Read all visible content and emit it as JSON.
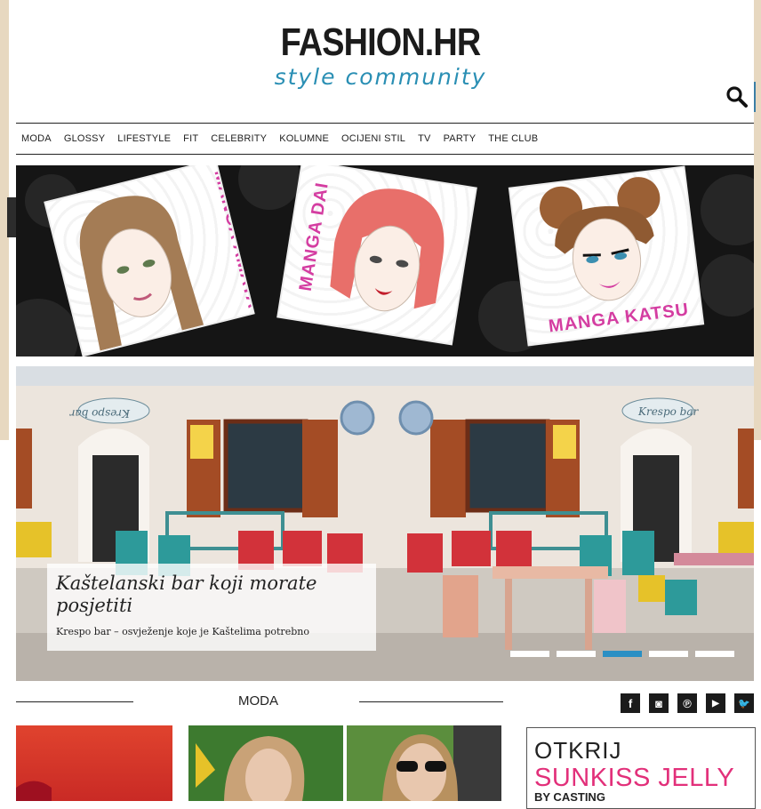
{
  "logo": {
    "main": "FASHION.HR",
    "sub": "style community"
  },
  "search": {
    "icon": "search-icon"
  },
  "nav": {
    "items": [
      "MODA",
      "GLOSSY",
      "LIFESTYLE",
      "FIT",
      "CELEBRITY",
      "KOLUMNE",
      "OCIJENI STIL",
      "TV",
      "PARTY",
      "THE CLUB"
    ]
  },
  "banner": {
    "cards": [
      {
        "label": "MANGA AMAYA"
      },
      {
        "label": "MANGA DAI"
      },
      {
        "label": "MANGA KATSU"
      }
    ]
  },
  "hero": {
    "title": "Kaštelanski bar koji morate posjetiti",
    "subtitle": "Krespo bar – osvježenje koje je Kaštelima potrebno",
    "sign": "Krespo bar",
    "slides": 5,
    "active_slide": 3
  },
  "section": {
    "title": "MODA"
  },
  "social": [
    {
      "icon": "facebook-icon",
      "glyph": "f"
    },
    {
      "icon": "instagram-icon",
      "glyph": "◙"
    },
    {
      "icon": "pinterest-icon",
      "glyph": "℗"
    },
    {
      "icon": "youtube-icon",
      "glyph": "▶"
    },
    {
      "icon": "twitter-icon",
      "glyph": "🐦"
    }
  ],
  "ad": {
    "line1": "OTKRIJ",
    "line2": "SUNKISS JELLY",
    "line3": "BY CASTING"
  },
  "colors": {
    "accent": "#2a8fb4",
    "brand_pink": "#d43da1",
    "ad_pink": "#e2307a",
    "active_dot": "#2a8fc4"
  }
}
